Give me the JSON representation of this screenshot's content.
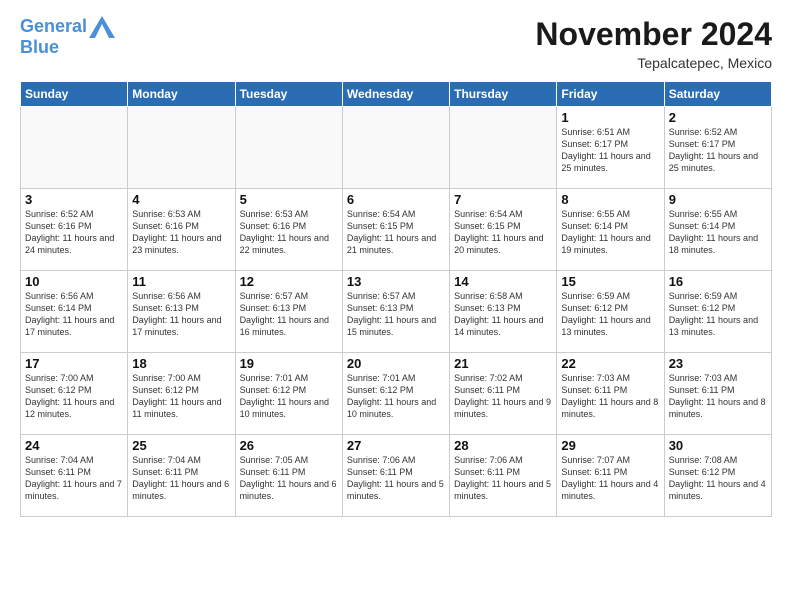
{
  "header": {
    "logo_line1": "General",
    "logo_line2": "Blue",
    "month": "November 2024",
    "location": "Tepalcatepec, Mexico"
  },
  "weekdays": [
    "Sunday",
    "Monday",
    "Tuesday",
    "Wednesday",
    "Thursday",
    "Friday",
    "Saturday"
  ],
  "weeks": [
    [
      {
        "day": "",
        "info": ""
      },
      {
        "day": "",
        "info": ""
      },
      {
        "day": "",
        "info": ""
      },
      {
        "day": "",
        "info": ""
      },
      {
        "day": "",
        "info": ""
      },
      {
        "day": "1",
        "info": "Sunrise: 6:51 AM\nSunset: 6:17 PM\nDaylight: 11 hours\nand 25 minutes."
      },
      {
        "day": "2",
        "info": "Sunrise: 6:52 AM\nSunset: 6:17 PM\nDaylight: 11 hours\nand 25 minutes."
      }
    ],
    [
      {
        "day": "3",
        "info": "Sunrise: 6:52 AM\nSunset: 6:16 PM\nDaylight: 11 hours\nand 24 minutes."
      },
      {
        "day": "4",
        "info": "Sunrise: 6:53 AM\nSunset: 6:16 PM\nDaylight: 11 hours\nand 23 minutes."
      },
      {
        "day": "5",
        "info": "Sunrise: 6:53 AM\nSunset: 6:16 PM\nDaylight: 11 hours\nand 22 minutes."
      },
      {
        "day": "6",
        "info": "Sunrise: 6:54 AM\nSunset: 6:15 PM\nDaylight: 11 hours\nand 21 minutes."
      },
      {
        "day": "7",
        "info": "Sunrise: 6:54 AM\nSunset: 6:15 PM\nDaylight: 11 hours\nand 20 minutes."
      },
      {
        "day": "8",
        "info": "Sunrise: 6:55 AM\nSunset: 6:14 PM\nDaylight: 11 hours\nand 19 minutes."
      },
      {
        "day": "9",
        "info": "Sunrise: 6:55 AM\nSunset: 6:14 PM\nDaylight: 11 hours\nand 18 minutes."
      }
    ],
    [
      {
        "day": "10",
        "info": "Sunrise: 6:56 AM\nSunset: 6:14 PM\nDaylight: 11 hours\nand 17 minutes."
      },
      {
        "day": "11",
        "info": "Sunrise: 6:56 AM\nSunset: 6:13 PM\nDaylight: 11 hours\nand 17 minutes."
      },
      {
        "day": "12",
        "info": "Sunrise: 6:57 AM\nSunset: 6:13 PM\nDaylight: 11 hours\nand 16 minutes."
      },
      {
        "day": "13",
        "info": "Sunrise: 6:57 AM\nSunset: 6:13 PM\nDaylight: 11 hours\nand 15 minutes."
      },
      {
        "day": "14",
        "info": "Sunrise: 6:58 AM\nSunset: 6:13 PM\nDaylight: 11 hours\nand 14 minutes."
      },
      {
        "day": "15",
        "info": "Sunrise: 6:59 AM\nSunset: 6:12 PM\nDaylight: 11 hours\nand 13 minutes."
      },
      {
        "day": "16",
        "info": "Sunrise: 6:59 AM\nSunset: 6:12 PM\nDaylight: 11 hours\nand 13 minutes."
      }
    ],
    [
      {
        "day": "17",
        "info": "Sunrise: 7:00 AM\nSunset: 6:12 PM\nDaylight: 11 hours\nand 12 minutes."
      },
      {
        "day": "18",
        "info": "Sunrise: 7:00 AM\nSunset: 6:12 PM\nDaylight: 11 hours\nand 11 minutes."
      },
      {
        "day": "19",
        "info": "Sunrise: 7:01 AM\nSunset: 6:12 PM\nDaylight: 11 hours\nand 10 minutes."
      },
      {
        "day": "20",
        "info": "Sunrise: 7:01 AM\nSunset: 6:12 PM\nDaylight: 11 hours\nand 10 minutes."
      },
      {
        "day": "21",
        "info": "Sunrise: 7:02 AM\nSunset: 6:11 PM\nDaylight: 11 hours\nand 9 minutes."
      },
      {
        "day": "22",
        "info": "Sunrise: 7:03 AM\nSunset: 6:11 PM\nDaylight: 11 hours\nand 8 minutes."
      },
      {
        "day": "23",
        "info": "Sunrise: 7:03 AM\nSunset: 6:11 PM\nDaylight: 11 hours\nand 8 minutes."
      }
    ],
    [
      {
        "day": "24",
        "info": "Sunrise: 7:04 AM\nSunset: 6:11 PM\nDaylight: 11 hours\nand 7 minutes."
      },
      {
        "day": "25",
        "info": "Sunrise: 7:04 AM\nSunset: 6:11 PM\nDaylight: 11 hours\nand 6 minutes."
      },
      {
        "day": "26",
        "info": "Sunrise: 7:05 AM\nSunset: 6:11 PM\nDaylight: 11 hours\nand 6 minutes."
      },
      {
        "day": "27",
        "info": "Sunrise: 7:06 AM\nSunset: 6:11 PM\nDaylight: 11 hours\nand 5 minutes."
      },
      {
        "day": "28",
        "info": "Sunrise: 7:06 AM\nSunset: 6:11 PM\nDaylight: 11 hours\nand 5 minutes."
      },
      {
        "day": "29",
        "info": "Sunrise: 7:07 AM\nSunset: 6:11 PM\nDaylight: 11 hours\nand 4 minutes."
      },
      {
        "day": "30",
        "info": "Sunrise: 7:08 AM\nSunset: 6:12 PM\nDaylight: 11 hours\nand 4 minutes."
      }
    ]
  ]
}
